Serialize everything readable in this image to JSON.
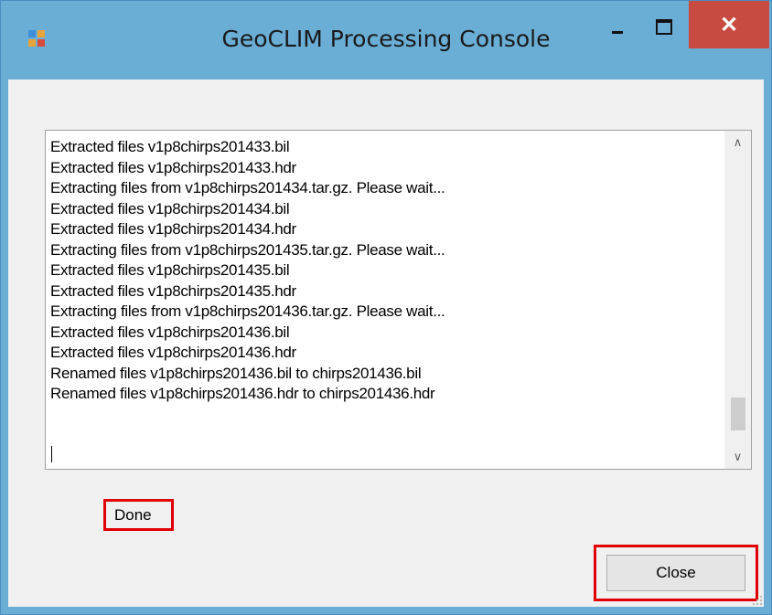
{
  "window": {
    "title": "GeoCLIM Processing Console",
    "close_glyph": "✕",
    "icons": [
      "app-icon",
      "minimize-icon",
      "maximize-icon",
      "close-icon"
    ]
  },
  "log": {
    "lines": [
      "Extracted files v1p8chirps201433.bil",
      "Extracted files v1p8chirps201433.hdr",
      "Extracting files from v1p8chirps201434.tar.gz. Please wait...",
      "Extracted files v1p8chirps201434.bil",
      "Extracted files v1p8chirps201434.hdr",
      "Extracting files from v1p8chirps201435.tar.gz. Please wait...",
      "Extracted files v1p8chirps201435.bil",
      "Extracted files v1p8chirps201435.hdr",
      "Extracting files from v1p8chirps201436.tar.gz. Please wait...",
      "Extracted files v1p8chirps201436.bil",
      "Extracted files v1p8chirps201436.hdr",
      "Renamed files v1p8chirps201436.bil to chirps201436.bil",
      "Renamed files v1p8chirps201436.hdr to chirps201436.hdr"
    ],
    "scroll_up_glyph": "∧",
    "scroll_down_glyph": "∨"
  },
  "status": {
    "label": "Done"
  },
  "buttons": {
    "close_label": "Close"
  },
  "colors": {
    "frame": "#6aaed6",
    "close_button": "#c74b40",
    "highlight": "#e00000",
    "client": "#f0f0f0"
  }
}
